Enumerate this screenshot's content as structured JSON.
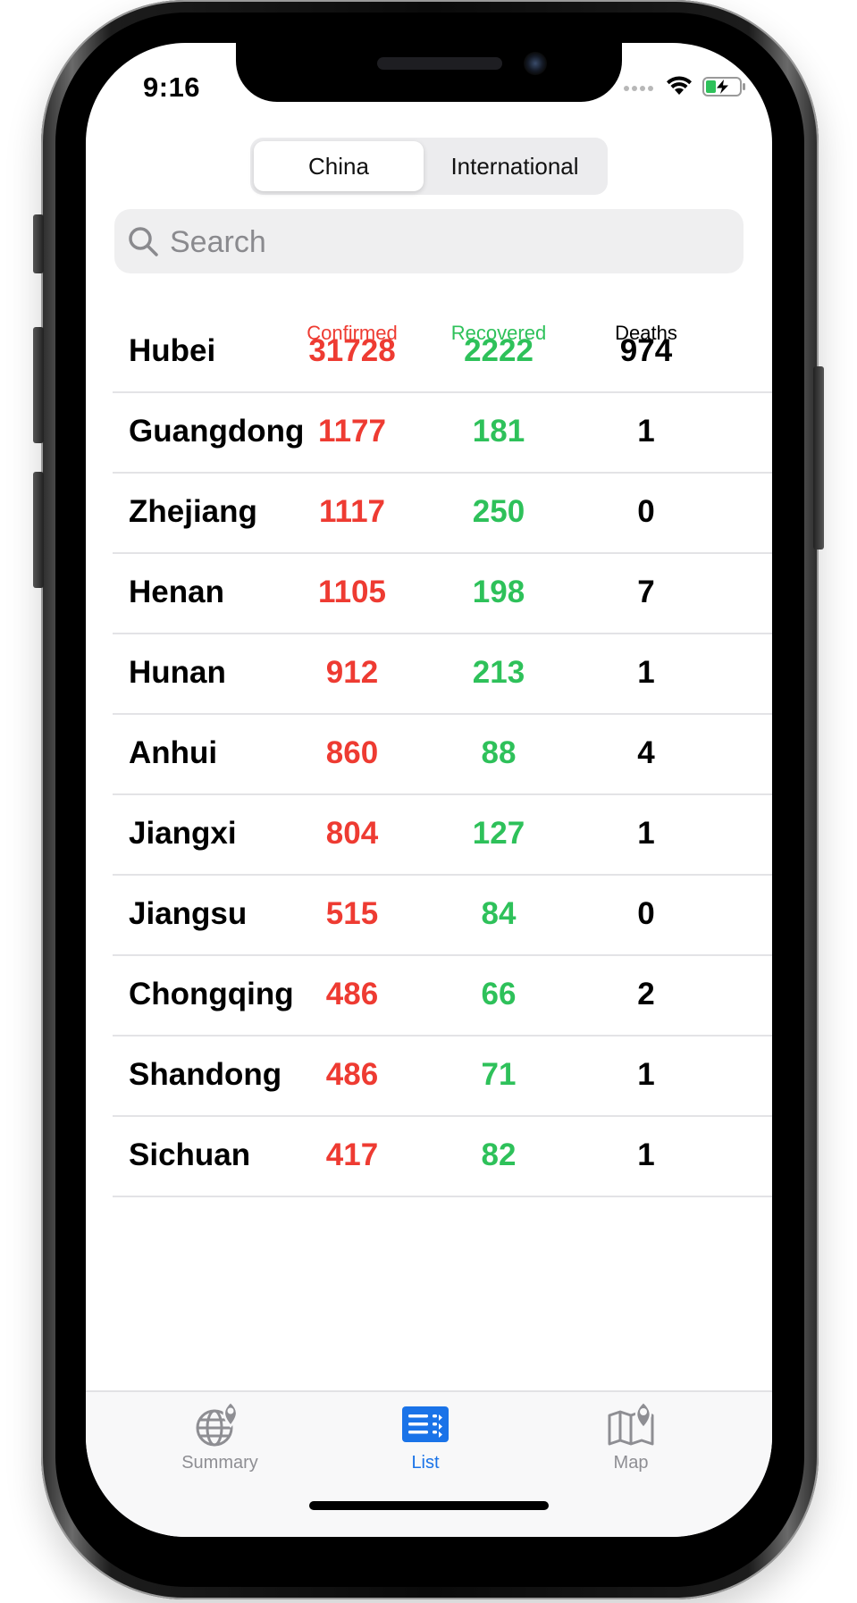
{
  "status_bar": {
    "time": "9:16"
  },
  "segmented_control": {
    "options": [
      {
        "label": "China",
        "selected": true
      },
      {
        "label": "International",
        "selected": false
      }
    ]
  },
  "search": {
    "placeholder": "Search",
    "value": ""
  },
  "table": {
    "headers": {
      "confirmed": "Confirmed",
      "recovered": "Recovered",
      "deaths": "Deaths"
    },
    "rows": [
      {
        "name": "Hubei",
        "confirmed": "31728",
        "recovered": "2222",
        "deaths": "974"
      },
      {
        "name": "Guangdong",
        "confirmed": "1177",
        "recovered": "181",
        "deaths": "1"
      },
      {
        "name": "Zhejiang",
        "confirmed": "1117",
        "recovered": "250",
        "deaths": "0"
      },
      {
        "name": "Henan",
        "confirmed": "1105",
        "recovered": "198",
        "deaths": "7"
      },
      {
        "name": "Hunan",
        "confirmed": "912",
        "recovered": "213",
        "deaths": "1"
      },
      {
        "name": "Anhui",
        "confirmed": "860",
        "recovered": "88",
        "deaths": "4"
      },
      {
        "name": "Jiangxi",
        "confirmed": "804",
        "recovered": "127",
        "deaths": "1"
      },
      {
        "name": "Jiangsu",
        "confirmed": "515",
        "recovered": "84",
        "deaths": "0"
      },
      {
        "name": "Chongqing",
        "confirmed": "486",
        "recovered": "66",
        "deaths": "2"
      },
      {
        "name": "Shandong",
        "confirmed": "486",
        "recovered": "71",
        "deaths": "1"
      },
      {
        "name": "Sichuan",
        "confirmed": "417",
        "recovered": "82",
        "deaths": "1"
      }
    ]
  },
  "tab_bar": {
    "tabs": [
      {
        "label": "Summary",
        "icon": "globe-pin-icon",
        "active": false
      },
      {
        "label": "List",
        "icon": "list-icon",
        "active": true
      },
      {
        "label": "Map",
        "icon": "map-pin-icon",
        "active": false
      }
    ]
  },
  "colors": {
    "confirmed": "#ee3b32",
    "recovered": "#2ec15a",
    "deaths": "#000000",
    "accent": "#1a73e8"
  }
}
